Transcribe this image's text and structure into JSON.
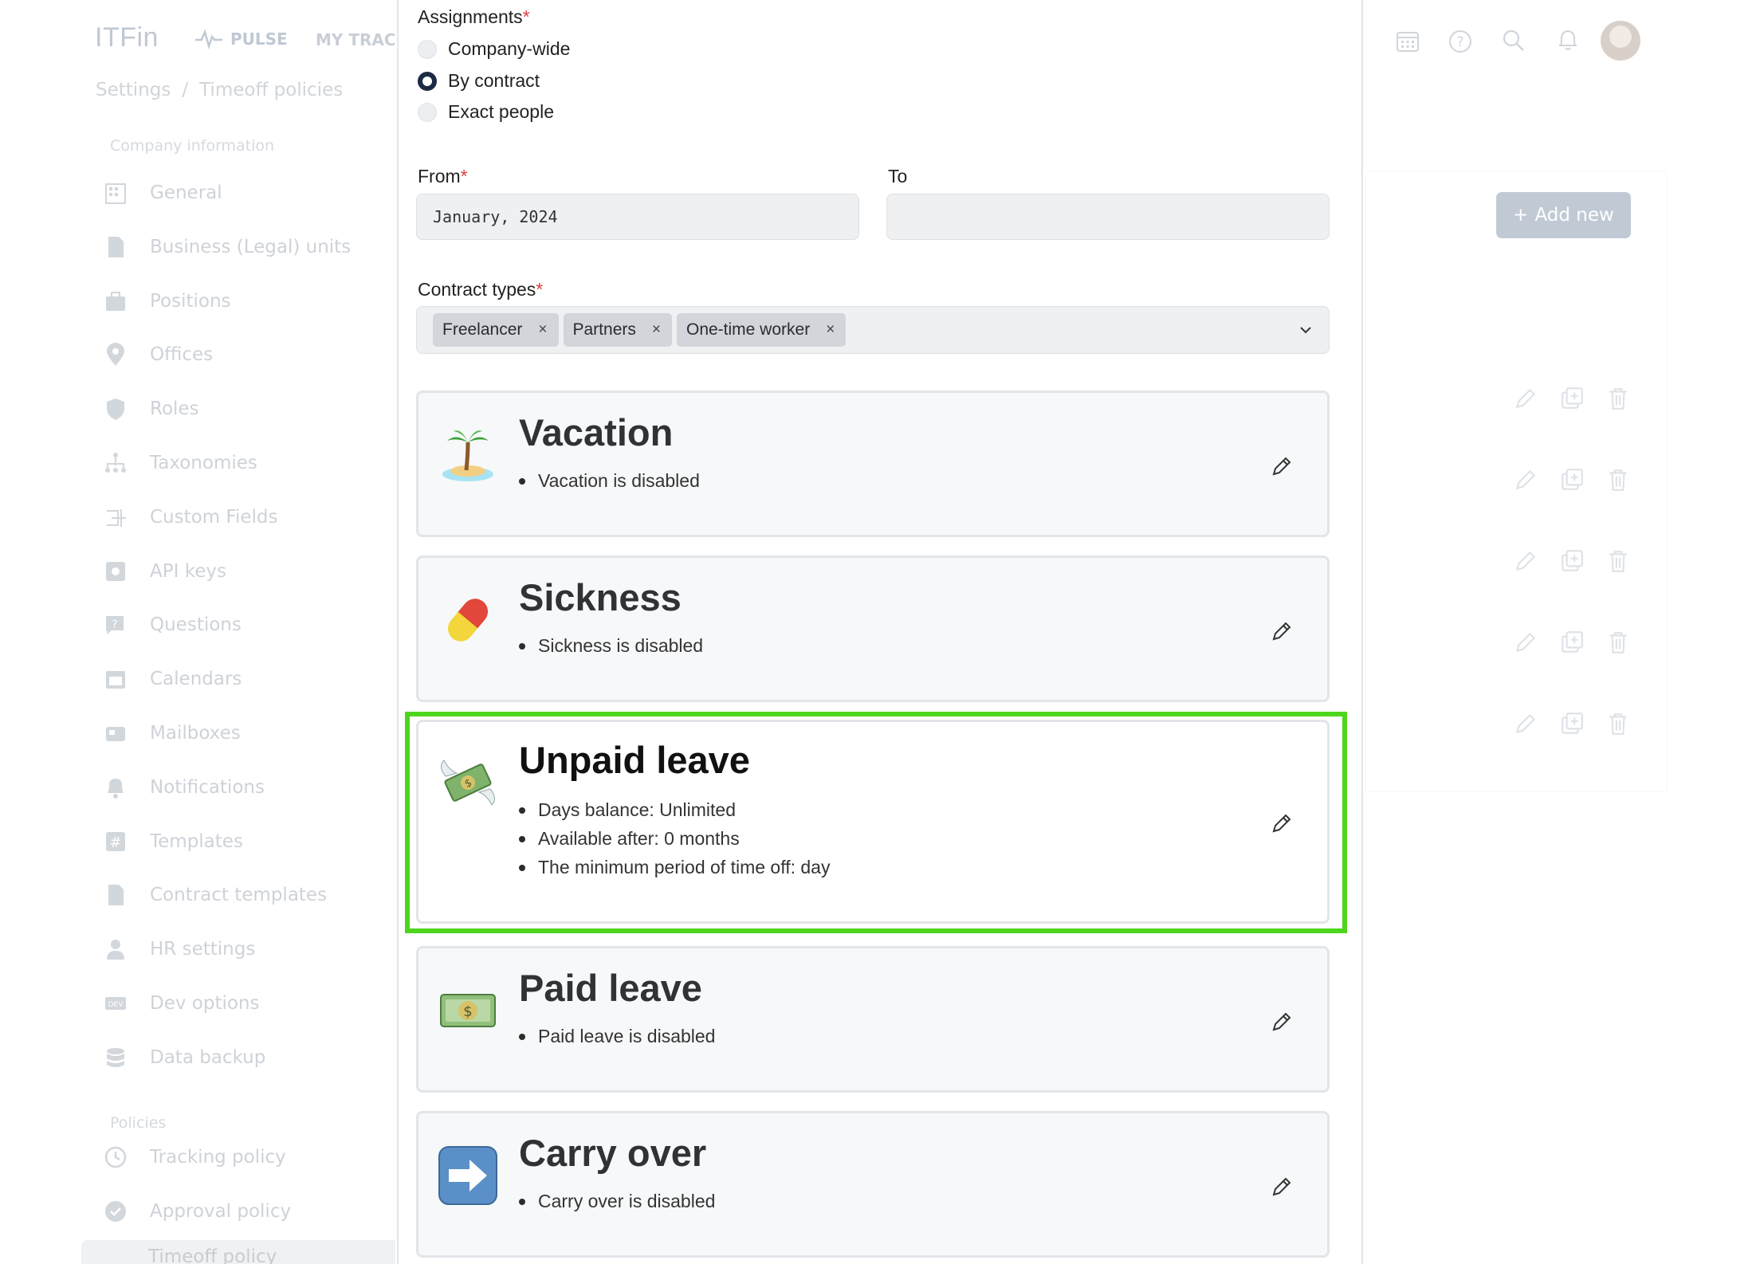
{
  "app": {
    "logo": "ITFin",
    "nav_pulse": "PULSE",
    "nav_tracker": "MY TRACKER"
  },
  "breadcrumb": {
    "root": "Settings",
    "sep": "/",
    "current": "Timeoff policies"
  },
  "sidebar": {
    "section_company": "Company information",
    "items": [
      {
        "label": "General",
        "icon": "building-icon"
      },
      {
        "label": "Business (Legal) units",
        "icon": "document-icon"
      },
      {
        "label": "Positions",
        "icon": "briefcase-icon"
      },
      {
        "label": "Offices",
        "icon": "location-pin-icon"
      },
      {
        "label": "Roles",
        "icon": "shield-icon"
      },
      {
        "label": "Taxonomies",
        "icon": "hierarchy-icon"
      },
      {
        "label": "Custom Fields",
        "icon": "custom-field-icon"
      },
      {
        "label": "API keys",
        "icon": "api-key-icon"
      },
      {
        "label": "Questions",
        "icon": "question-chat-icon"
      },
      {
        "label": "Calendars",
        "icon": "calendar-icon"
      },
      {
        "label": "Mailboxes",
        "icon": "mailbox-icon"
      },
      {
        "label": "Notifications",
        "icon": "bell-icon"
      },
      {
        "label": "Templates",
        "icon": "hash-icon"
      },
      {
        "label": "Contract templates",
        "icon": "file-icon"
      },
      {
        "label": "HR settings",
        "icon": "person-icon"
      },
      {
        "label": "Dev options",
        "icon": "dev-icon"
      },
      {
        "label": "Data backup",
        "icon": "database-icon"
      }
    ],
    "section_policies": "Policies",
    "policy_items": [
      {
        "label": "Tracking policy",
        "icon": "clock-icon"
      },
      {
        "label": "Approval policy",
        "icon": "badge-check-icon"
      }
    ],
    "active_item": "Timeoff policy"
  },
  "page": {
    "add_new": "Add new"
  },
  "modal": {
    "assignments_label": "Assignments",
    "required_mark": "*",
    "options": [
      {
        "label": "Company-wide",
        "selected": false
      },
      {
        "label": "By contract",
        "selected": true
      },
      {
        "label": "Exact people",
        "selected": false
      }
    ],
    "from_label": "From",
    "from_value": "January, 2024",
    "to_label": "To",
    "to_value": "",
    "contract_types_label": "Contract types",
    "contract_types": [
      "Freelancer",
      "Partners",
      "One-time worker"
    ],
    "chip_remove": "×",
    "cards": [
      {
        "title": "Vacation",
        "emoji": "palm-island-icon",
        "bullets": [
          "Vacation is disabled"
        ]
      },
      {
        "title": "Sickness",
        "emoji": "pill-icon",
        "bullets": [
          "Sickness is disabled"
        ]
      },
      {
        "title": "Unpaid leave",
        "emoji": "money-wings-icon",
        "bullets": [
          "Days balance: Unlimited",
          "Available after: 0 months",
          "The minimum period of time off: day"
        ]
      },
      {
        "title": "Paid leave",
        "emoji": "dollar-bill-icon",
        "bullets": [
          "Paid leave is disabled"
        ]
      },
      {
        "title": "Carry over",
        "emoji": "right-arrow-icon",
        "bullets": [
          "Carry over is disabled"
        ]
      }
    ]
  },
  "colors": {
    "highlight": "#4ed61f",
    "primary": "#1c2a44",
    "required": "#e23b3b",
    "add_button": "#8f9fb1"
  }
}
